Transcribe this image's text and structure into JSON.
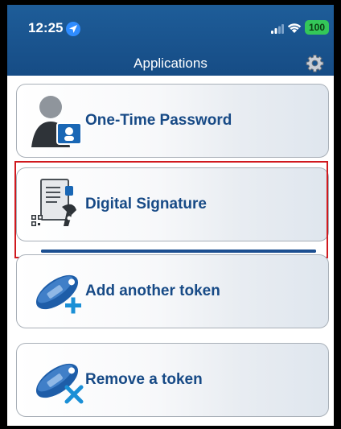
{
  "status_bar": {
    "time": "12:25",
    "battery": "100",
    "location_icon": "location-arrow-icon",
    "signal_icon": "cellular-signal-icon",
    "wifi_icon": "wifi-icon"
  },
  "header": {
    "title": "Applications",
    "settings_icon": "gear-icon"
  },
  "applications": [
    {
      "label": "One-Time Password",
      "icon": "user-otp-icon"
    },
    {
      "label": "Digital Signature",
      "icon": "document-signature-icon"
    },
    {
      "label": "Add another token",
      "icon": "token-add-icon"
    },
    {
      "label": "Remove a token",
      "icon": "token-remove-icon"
    }
  ],
  "progress": {
    "fraction": 1.0
  },
  "colors": {
    "header_bg": "#1a5590",
    "label_text": "#174a86",
    "highlight_border": "#d0191e",
    "battery": "#34c759"
  }
}
